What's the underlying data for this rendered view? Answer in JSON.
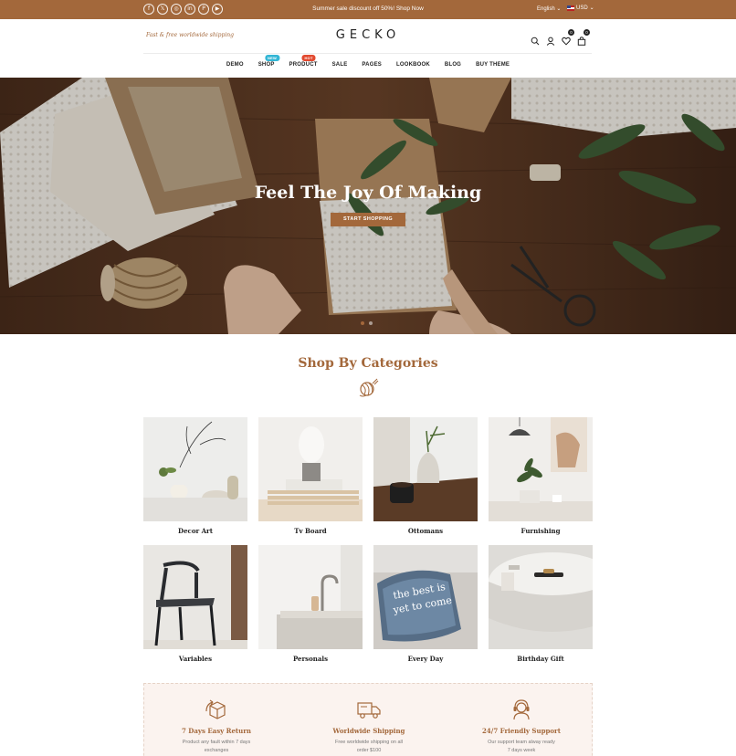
{
  "topbar": {
    "socials": [
      {
        "icon": "facebook-icon",
        "glyph": "f"
      },
      {
        "icon": "x-twitter-icon",
        "glyph": "𝕏"
      },
      {
        "icon": "instagram-icon",
        "glyph": "◎"
      },
      {
        "icon": "linkedin-icon",
        "glyph": "in"
      },
      {
        "icon": "pinterest-icon",
        "glyph": "P"
      },
      {
        "icon": "youtube-icon",
        "glyph": "▶"
      }
    ],
    "promo": "Summer sale discount off 50%! Shop Now",
    "language": "English",
    "currency": "USD"
  },
  "header": {
    "shipping_note": "Fast & free worldwide shipping",
    "logo": "GECKO",
    "wishlist_count": "0",
    "cart_count": "0"
  },
  "nav": [
    {
      "label": "DEMO",
      "tag": null
    },
    {
      "label": "SHOP",
      "tag": "NEW"
    },
    {
      "label": "PRODUCT",
      "tag": "HOT"
    },
    {
      "label": "SALE",
      "tag": null
    },
    {
      "label": "PAGES",
      "tag": null
    },
    {
      "label": "LOOKBOOK",
      "tag": null
    },
    {
      "label": "BLOG",
      "tag": null
    },
    {
      "label": "BUY THEME",
      "tag": null
    }
  ],
  "hero": {
    "title": "Feel The Joy Of Making",
    "button": "START SHOPPING",
    "slides": 2,
    "active_slide": 1
  },
  "categories": {
    "title": "Shop By Categories",
    "items": [
      {
        "label": "Decor Art"
      },
      {
        "label": "Tv Board"
      },
      {
        "label": "Ottomans"
      },
      {
        "label": "Furnishing"
      },
      {
        "label": "Variables"
      },
      {
        "label": "Personals"
      },
      {
        "label": "Every Day"
      },
      {
        "label": "Birthday Gift"
      }
    ]
  },
  "features": [
    {
      "icon": "box-return-icon",
      "title": "7 Days Easy Return",
      "desc1": "Product any fault within 7 days",
      "desc2": "exchanges"
    },
    {
      "icon": "delivery-truck-icon",
      "title": "Worldwide Shipping",
      "desc1": "Free worldwide shipping on all",
      "desc2": "order $100"
    },
    {
      "icon": "support-headset-icon",
      "title": "24/7 Friendly Support",
      "desc1": "Our support team alway ready",
      "desc2": "7 days week"
    }
  ],
  "colors": {
    "accent": "#a3683b",
    "dark": "#222222",
    "feature_bg": "#fbf3ef"
  }
}
